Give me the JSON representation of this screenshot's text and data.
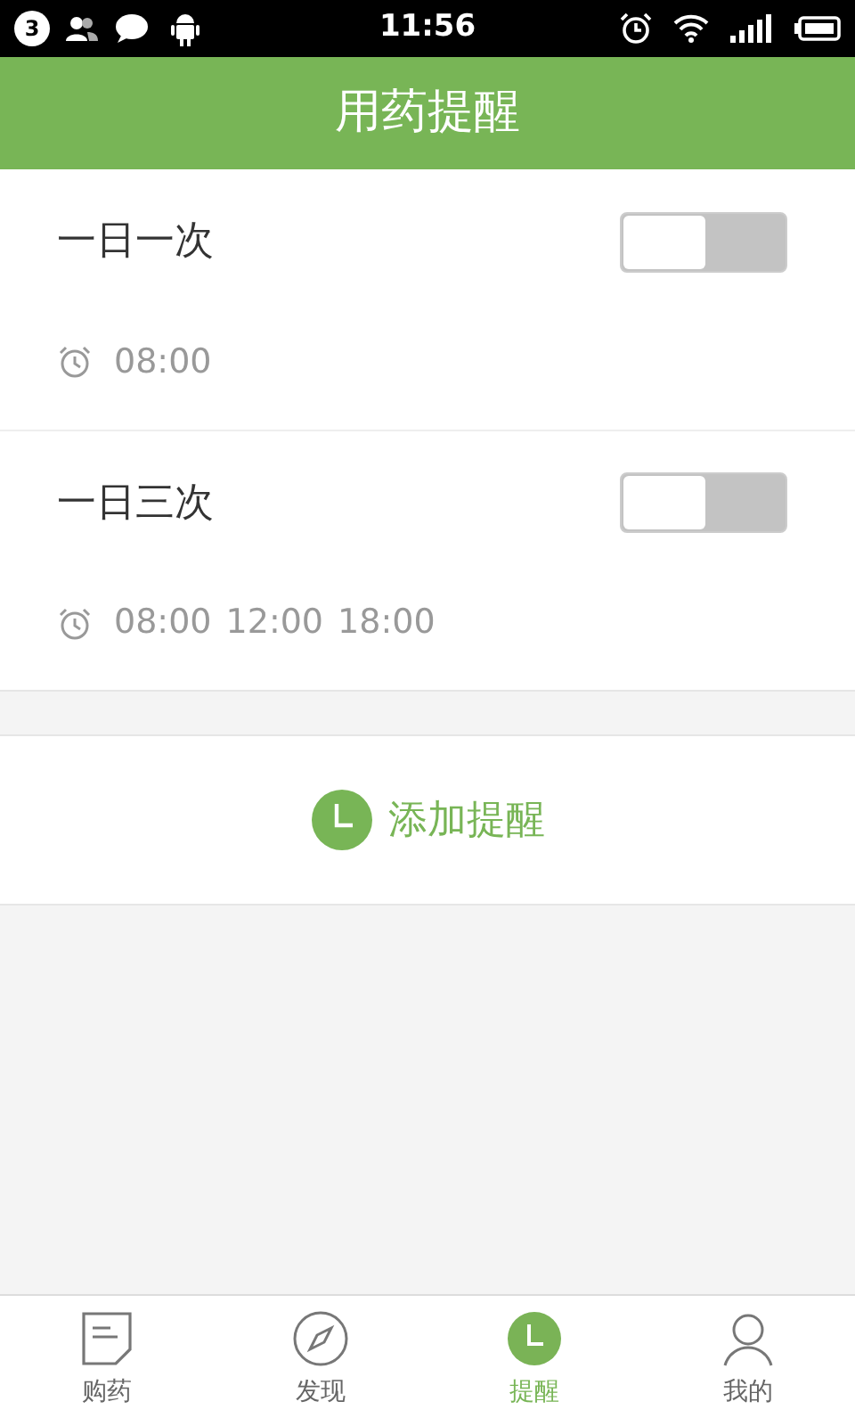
{
  "status_bar": {
    "notification_count": "3",
    "time": "11:56"
  },
  "header": {
    "title": "用药提醒"
  },
  "reminders": [
    {
      "name": "一日一次",
      "on": false,
      "times": [
        "08:00"
      ]
    },
    {
      "name": "一日三次",
      "on": false,
      "times": [
        "08:00",
        "12:00",
        "18:00"
      ]
    }
  ],
  "add_button": {
    "label": "添加提醒"
  },
  "nav": [
    {
      "label": "购药",
      "kind": "note",
      "selected": false
    },
    {
      "label": "发现",
      "kind": "compass",
      "selected": false
    },
    {
      "label": "提醒",
      "kind": "clock",
      "selected": true
    },
    {
      "label": "我的",
      "kind": "person",
      "selected": false
    }
  ]
}
